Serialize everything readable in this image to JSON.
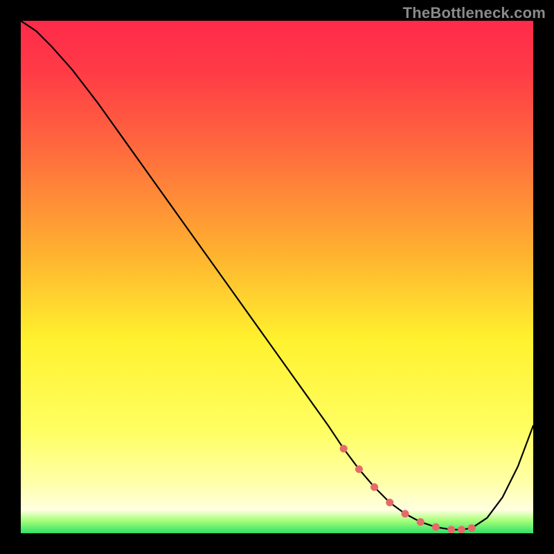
{
  "attribution": "TheBottleneck.com",
  "colors": {
    "marker": "#e66a6a",
    "curve": "#000000",
    "frame": "#000000"
  },
  "gradient_stops": [
    {
      "offset": 0.0,
      "color": "#ff2a4a"
    },
    {
      "offset": 0.1,
      "color": "#ff3b46"
    },
    {
      "offset": 0.25,
      "color": "#ff6a3e"
    },
    {
      "offset": 0.45,
      "color": "#ffb030"
    },
    {
      "offset": 0.62,
      "color": "#fff12e"
    },
    {
      "offset": 0.8,
      "color": "#ffff62"
    },
    {
      "offset": 0.9,
      "color": "#ffffa8"
    },
    {
      "offset": 0.955,
      "color": "#ffffe0"
    },
    {
      "offset": 0.975,
      "color": "#a8ff7a"
    },
    {
      "offset": 1.0,
      "color": "#2fe26a"
    }
  ],
  "chart_data": {
    "type": "line",
    "title": "",
    "xlabel": "",
    "ylabel": "",
    "xlim": [
      0,
      100
    ],
    "ylim": [
      0,
      100
    ],
    "x": [
      0,
      3,
      6,
      10,
      15,
      20,
      25,
      30,
      35,
      40,
      45,
      50,
      55,
      60,
      63,
      66,
      69,
      72,
      75,
      78,
      81,
      84,
      86,
      88,
      91,
      94,
      97,
      100
    ],
    "values": [
      100,
      98,
      95,
      90.5,
      84,
      77,
      70,
      63,
      56,
      49,
      42,
      35,
      28,
      21,
      16.5,
      12.5,
      9,
      6,
      3.8,
      2.2,
      1.2,
      0.7,
      0.7,
      1,
      3,
      7,
      13,
      21
    ],
    "markers_x": [
      63,
      66,
      69,
      72,
      75,
      78,
      81,
      84,
      86,
      88
    ],
    "axes_visible": false,
    "grid": false,
    "description": "V-shaped bottleneck curve. Y is a relative penalty/bottleneck percentage (100 = worst at top, 0 = best at bottom). X is a relative hardware balance position (0–100). Minimum near x≈83. Red markers indicate the recommended/optimal zone along the curve near the bottom."
  }
}
